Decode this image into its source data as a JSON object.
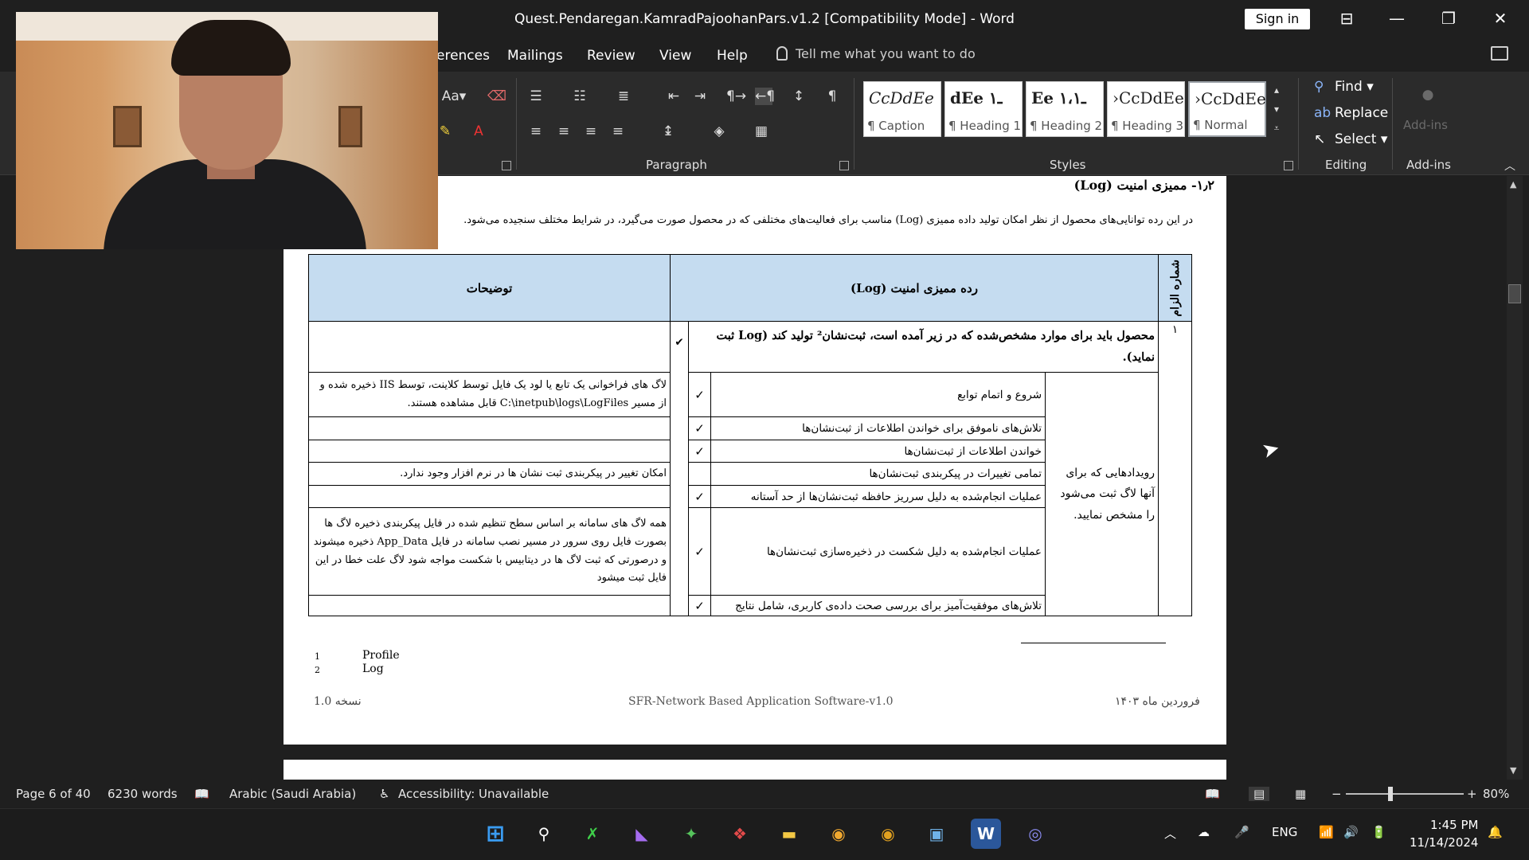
{
  "window": {
    "title": "Quest.Pendaregan.KamradPajoohanPars.v1.2 [Compatibility Mode]  -  Word",
    "sign_in": "Sign in",
    "minimize": "—",
    "restore": "❐",
    "close": "✕"
  },
  "menu": {
    "tabs": [
      "erences",
      "Mailings",
      "Review",
      "View",
      "Help"
    ],
    "tell_me": "Tell me what you want to do"
  },
  "ribbon": {
    "paragraph_label": "Paragraph",
    "styles_label": "Styles",
    "editing_label": "Editing",
    "addins_label": "Add-ins",
    "addins_button": "Add-ins",
    "styles": [
      {
        "sample": "CcDdEe",
        "name": "¶ Caption"
      },
      {
        "sample": "dEe  ـ١",
        "name": "¶ Heading 1"
      },
      {
        "sample": "Ee  ـ١،١",
        "name": "¶ Heading 2"
      },
      {
        "sample": "›CcDdEe",
        "name": "¶ Heading 3"
      },
      {
        "sample": "›CcDdEe",
        "name": "¶ Normal"
      }
    ],
    "editing": {
      "find": "Find",
      "replace": "Replace",
      "select": "Select"
    }
  },
  "document": {
    "section_heading": "۱٫۲- ممیزی امنیت (Log)",
    "intro": "در این رده توانایی‌های محصول از نظر امکان تولید داده ممیزی (Log) مناسب برای فعالیت‌های مختلفی که در محصول صورت می‌گیرد، در شرایط مختلف سنجیده می‌شود.",
    "table": {
      "col_number": "شماره الزام",
      "col_category": "رده ممیزی امنیت (Log)",
      "col_desc": "توضیحات",
      "req_number": "۱",
      "req_main": "محصول باید برای موارد مشخص‌شده که در زیر آمده است، ثبت‌نشان² تولید کند (Log ثبت نماید).",
      "group_label": "رویدادهایی که برای آنها لاگ ثبت می‌شود را مشخص نمایید.",
      "check": "✓",
      "main_check": "✔",
      "rows": [
        {
          "event": "شروع و اتمام توابع",
          "desc": "لاگ های فراخوانی یک تابع یا لود یک فایل توسط کلاینت، توسط IIS ذخیره شده و از مسیر C:\\inetpub\\logs\\LogFiles قابل مشاهده هستند.",
          "checked": true
        },
        {
          "event": "تلاش‌های ناموفق برای خواندن اطلاعات از ثبت‌نشان‌ها",
          "desc": "",
          "checked": true
        },
        {
          "event": "خواندن اطلاعات از ثبت‌نشان‌ها",
          "desc": "",
          "checked": true
        },
        {
          "event": "تمامی تغییرات در پیکربندی ثبت‌نشان‌ها",
          "desc": "امکان تغییر در پیکربندی ثبت نشان ها در نرم افزار وجود ندارد.",
          "checked": false
        },
        {
          "event": "عملیات انجام‌شده به دلیل سرریز حافظه ثبت‌نشان‌ها از حد آستانه",
          "desc": "",
          "checked": true
        },
        {
          "event": "عملیات انجام‌شده به دلیل شکست در ذخیره‌سازی ثبت‌نشان‌ها",
          "desc": "همه لاگ های سامانه بر اساس سطح تنظیم شده در فایل پیکربندی ذخیره لاگ ها بصورت فایل روی سرور در مسیر نصب سامانه در فایل App_Data ذخیره میشوند و درصورتی که ثبت لاگ ها در دیتابیس با شکست مواجه شود لاگ علت خطا در این فایل ثبت میشود",
          "checked": true
        },
        {
          "event": "تلاش‌های موفقیت‌آمیز برای بررسی صحت داده‌ی کاربری، شامل نتایج",
          "desc": "",
          "checked": true
        }
      ]
    },
    "footnotes": [
      {
        "num": "1",
        "text": "Profile"
      },
      {
        "num": "2",
        "text": "Log"
      }
    ],
    "footer_left": "1.0  نسخه",
    "footer_center": "SFR-Network Based Application Software-v1.0",
    "footer_right": "فروردین ماه ۱۴۰۳"
  },
  "status": {
    "page": "Page 6 of 40",
    "words": "6230 words",
    "language": "Arabic (Saudi Arabia)",
    "accessibility": "Accessibility: Unavailable",
    "zoom": "80%"
  },
  "taskbar": {
    "lang": "ENG",
    "time": "1:45 PM",
    "date": "11/14/2024"
  }
}
